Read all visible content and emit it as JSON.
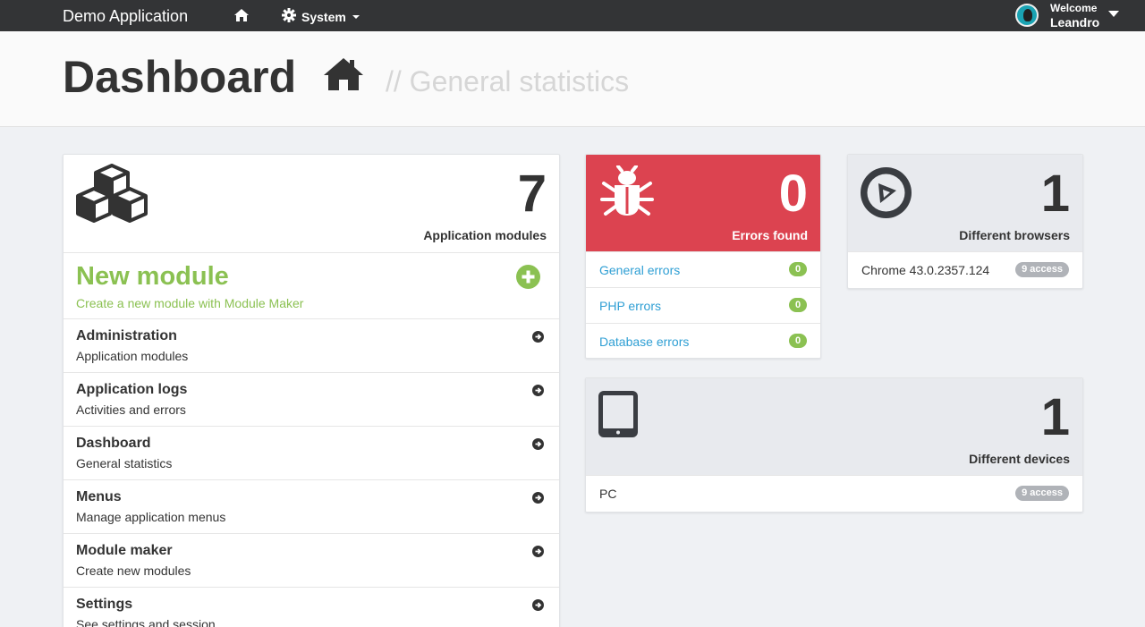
{
  "navbar": {
    "brand": "Demo Application",
    "system_label": "System",
    "welcome": "Welcome",
    "username": "Leandro"
  },
  "header": {
    "title": "Dashboard",
    "subtitle": "// General statistics"
  },
  "modules_card": {
    "count": "7",
    "label": "Application modules",
    "new_module": {
      "title": "New module",
      "description": "Create a new module with Module Maker"
    },
    "items": [
      {
        "name": "Administration",
        "description": "Application modules"
      },
      {
        "name": "Application logs",
        "description": "Activities and errors"
      },
      {
        "name": "Dashboard",
        "description": "General statistics"
      },
      {
        "name": "Menus",
        "description": "Manage application menus"
      },
      {
        "name": "Module maker",
        "description": "Create new modules"
      },
      {
        "name": "Settings",
        "description": "See settings and session"
      }
    ]
  },
  "errors_card": {
    "count": "0",
    "label": "Errors found",
    "items": [
      {
        "label": "General errors",
        "count": "0"
      },
      {
        "label": "PHP errors",
        "count": "0"
      },
      {
        "label": "Database errors",
        "count": "0"
      }
    ]
  },
  "browsers_card": {
    "count": "1",
    "label": "Different browsers",
    "item": {
      "name": "Chrome 43.0.2357.124",
      "access": "9 access"
    }
  },
  "devices_card": {
    "count": "1",
    "label": "Different devices",
    "item": {
      "name": "PC",
      "access": "9 access"
    }
  },
  "colors": {
    "navbar": "#333436",
    "danger": "#dc4350",
    "success": "#8bc152",
    "link": "#2f9fd4",
    "panel_gray": "#e8eaee"
  },
  "icons": [
    "home-icon",
    "gear-icon",
    "cubes-icon",
    "plus-circle-icon",
    "arrow-circle-right-icon",
    "bug-icon",
    "compass-icon",
    "tablet-icon"
  ]
}
